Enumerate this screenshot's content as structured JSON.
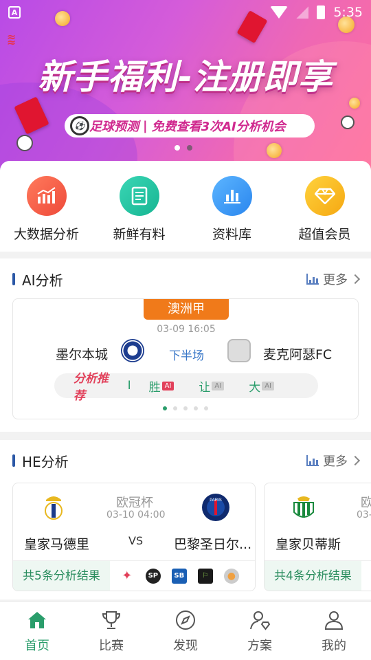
{
  "status": {
    "time": "5:35",
    "left_badge": "A"
  },
  "banner": {
    "title": "新手福利-注册即享",
    "subtitle_part1": "足球预测",
    "subtitle_sep": "|",
    "subtitle_part2": "免费查看3次AI分析机会",
    "active_index": 0
  },
  "quick_menu": [
    {
      "label": "大数据分析",
      "icon": "chart-icon",
      "color": "#f05a44"
    },
    {
      "label": "新鲜有料",
      "icon": "news-icon",
      "color": "#1fbf9f"
    },
    {
      "label": "资料库",
      "icon": "bar-chart-icon",
      "color": "#3a9cf0"
    },
    {
      "label": "超值会员",
      "icon": "diamond-icon",
      "color": "#f5b512"
    }
  ],
  "ai_section": {
    "title": "AI分析",
    "more": "更多",
    "card": {
      "league": "澳洲甲",
      "time": "03-09 16:05",
      "home": "墨尔本城",
      "away": "麦克阿瑟FC",
      "status": "下半场",
      "rec_title": "分析推荐",
      "rec_sep": "I",
      "picks": [
        {
          "label": "胜",
          "tag": "AI"
        },
        {
          "label": "让",
          "tag": "AI"
        },
        {
          "label": "大",
          "tag": "AI"
        }
      ]
    }
  },
  "he_section": {
    "title": "HE分析",
    "more": "更多",
    "cards": [
      {
        "competition": "欧冠杯",
        "time": "03-10 04:00",
        "home": "皇家马德里",
        "vs": "VS",
        "away": "巴黎圣日尔...",
        "count_text": "共5条分析结果"
      },
      {
        "competition": "欧",
        "time": "03-",
        "home": "皇家贝蒂斯",
        "count_text": "共4条分析结果"
      }
    ],
    "sources": [
      {
        "text": "✦",
        "color": "#e2405a"
      },
      {
        "text": "SP",
        "color": "#222"
      },
      {
        "text": "SB",
        "color": "#1a5fb4"
      },
      {
        "text": "⚐",
        "color": "#1a7a2e"
      },
      {
        "text": "●",
        "color": "#f0a040"
      }
    ]
  },
  "tabbar": [
    {
      "label": "首页",
      "icon": "home-icon",
      "active": true
    },
    {
      "label": "比赛",
      "icon": "trophy-icon",
      "active": false
    },
    {
      "label": "发现",
      "icon": "compass-icon",
      "active": false
    },
    {
      "label": "方案",
      "icon": "plan-icon",
      "active": false
    },
    {
      "label": "我的",
      "icon": "user-icon",
      "active": false
    }
  ]
}
